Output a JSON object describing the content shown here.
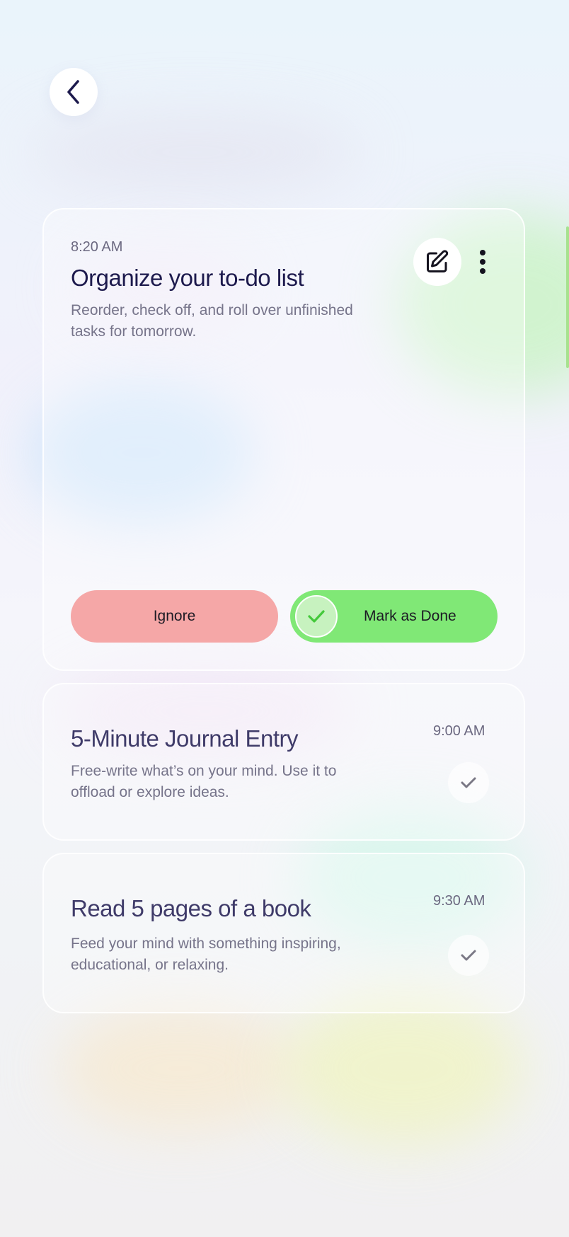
{
  "colors": {
    "primary_text": "#1d1a4d",
    "ignore_button": "#f5a7a7",
    "done_button": "#80e876",
    "check_icon": "#44c93b"
  },
  "nav": {
    "back_icon": "chevron-left-icon"
  },
  "active_task": {
    "time": "8:20 AM",
    "title": "Organize your to-do list",
    "description": "Reorder, check off, and roll over unfinished tasks for tomorrow.",
    "edit_icon": "edit-icon",
    "more_icon": "more-vertical-icon",
    "ignore_label": "Ignore",
    "done_label": "Mark as Done"
  },
  "upcoming_tasks": [
    {
      "time": "9:00 AM",
      "title": "5-Minute Journal Entry",
      "description": "Free-write what’s on your mind. Use it to offload or explore ideas.",
      "icon": "check-icon"
    },
    {
      "time": "9:30 AM",
      "title": "Read 5 pages of a book",
      "description": "Feed your mind with something inspiring, educational, or relaxing.",
      "icon": "check-icon"
    }
  ]
}
